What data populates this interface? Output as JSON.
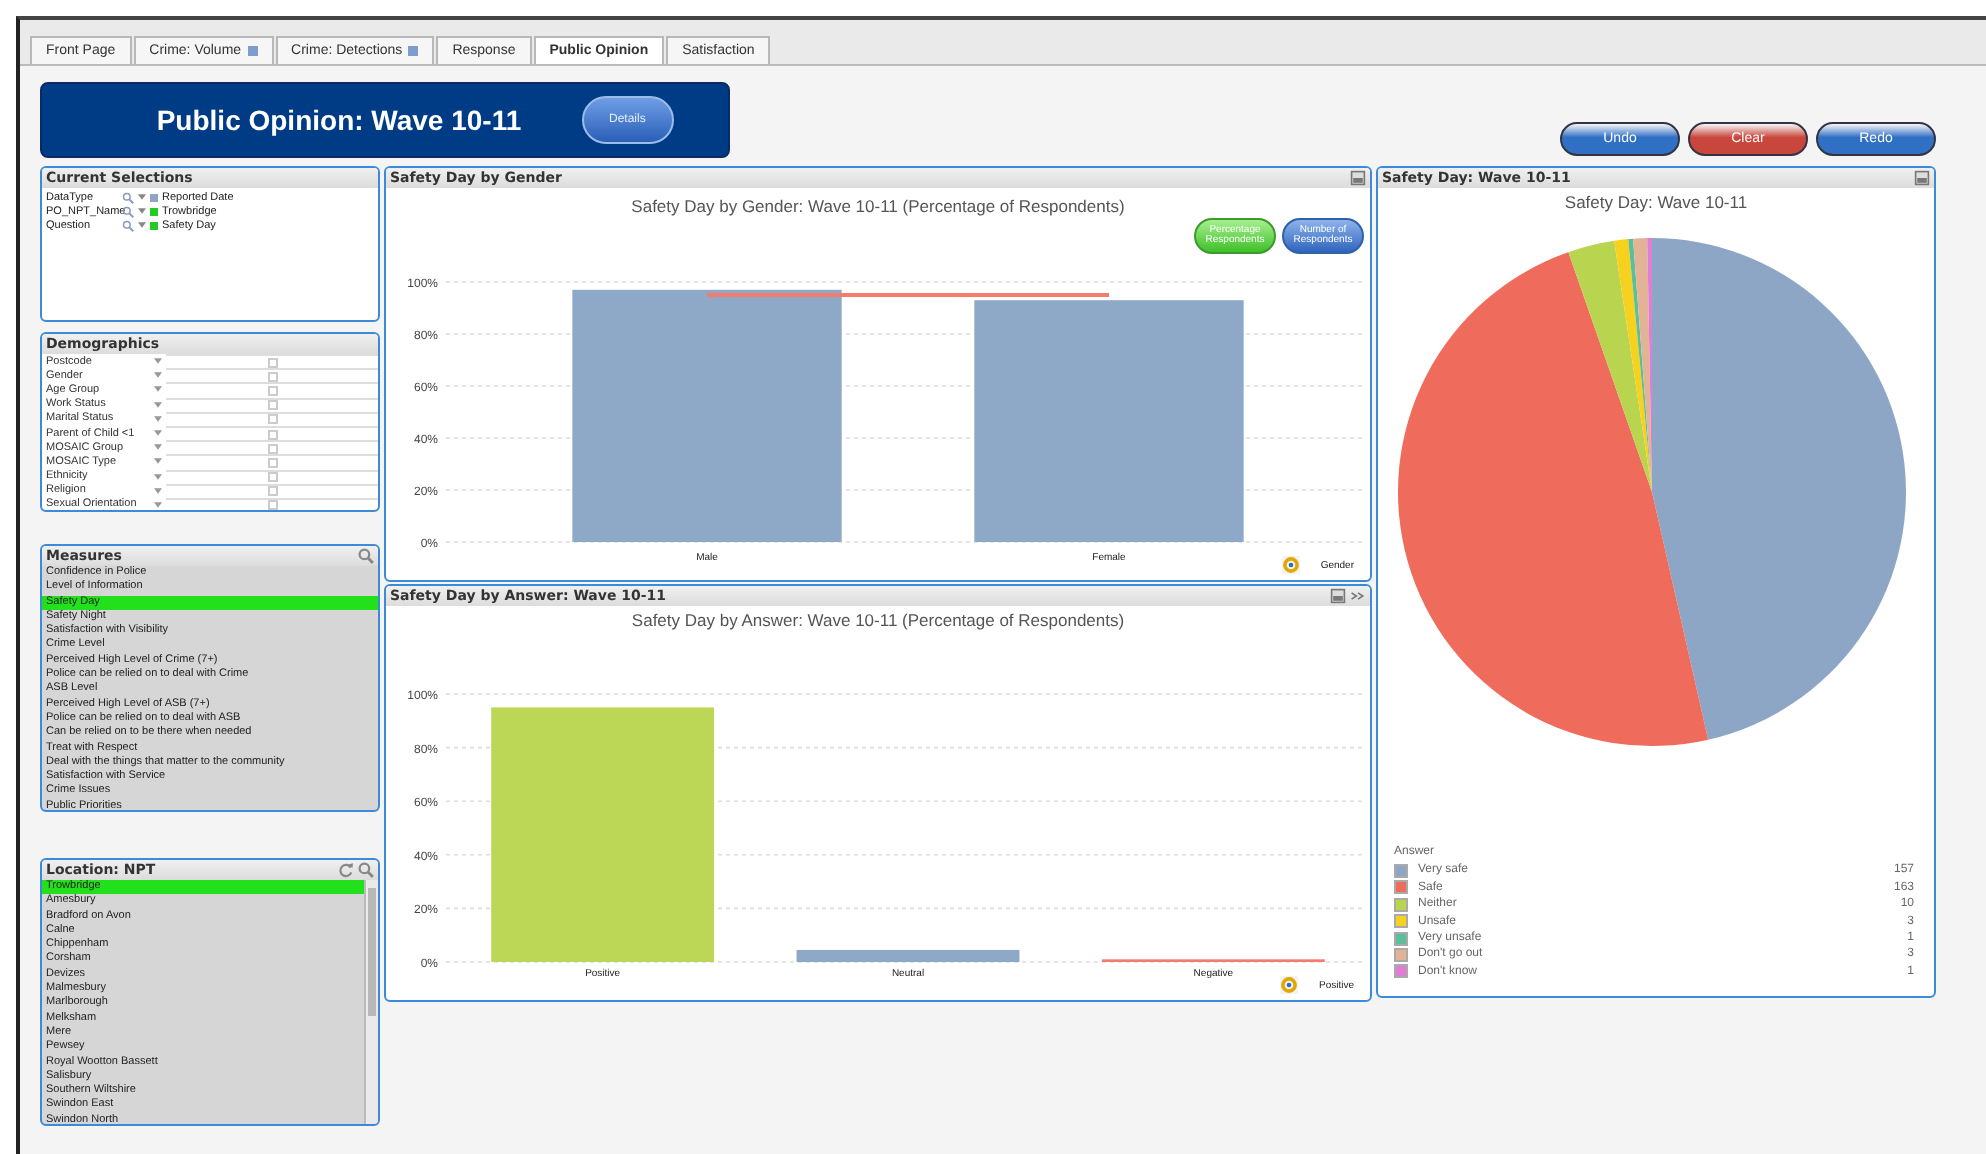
{
  "tabs": [
    {
      "label": "Front Page",
      "selected": false,
      "marker": false
    },
    {
      "label": "Crime: Volume",
      "selected": false,
      "marker": true
    },
    {
      "label": "Crime: Detections",
      "selected": false,
      "marker": true
    },
    {
      "label": "Response",
      "selected": false,
      "marker": false
    },
    {
      "label": "Public Opinion",
      "selected": true,
      "marker": false
    },
    {
      "label": "Satisfaction",
      "selected": false,
      "marker": false
    }
  ],
  "banner": {
    "title": "Public Opinion: Wave 10-11",
    "details_button": "Details"
  },
  "action_buttons": [
    {
      "label": "Undo",
      "color": "#2f6fc4"
    },
    {
      "label": "Clear",
      "color": "#c8463c"
    },
    {
      "label": "Redo",
      "color": "#2f6fc4"
    }
  ],
  "current_selections": {
    "title": "Current Selections",
    "rows": [
      {
        "field": "DataType",
        "value": "Reported Date",
        "color": "#8ea6c6"
      },
      {
        "field": "PO_NPT_Name",
        "value": "Trowbridge",
        "color": "#22cc22"
      },
      {
        "field": "Question",
        "value": "Safety Day",
        "color": "#22cc22"
      }
    ]
  },
  "demographics": {
    "title": "Demographics",
    "rows": [
      {
        "label": "Postcode",
        "checked": false
      },
      {
        "label": "Gender",
        "checked": false
      },
      {
        "label": "Age Group",
        "checked": false
      },
      {
        "label": "Work Status",
        "checked": false
      },
      {
        "label": "Marital Status",
        "checked": false
      },
      {
        "label": "Parent of Child <1",
        "checked": false
      },
      {
        "label": "MOSAIC Group",
        "checked": false
      },
      {
        "label": "MOSAIC Type",
        "checked": false
      },
      {
        "label": "Ethnicity",
        "checked": false
      },
      {
        "label": "Religion",
        "checked": false
      },
      {
        "label": "Sexual Orientation",
        "checked": false
      }
    ]
  },
  "measures": {
    "title": "Measures",
    "items": [
      {
        "label": "Confidence in Police",
        "selected": false
      },
      {
        "label": "Level of Information",
        "selected": false
      },
      {
        "label": "Safety Day",
        "selected": true
      },
      {
        "label": "Safety Night",
        "selected": false
      },
      {
        "label": "Satisfaction with Visibility",
        "selected": false
      },
      {
        "label": "Crime Level",
        "selected": false
      },
      {
        "label": "Perceived High Level of Crime (7+)",
        "selected": false
      },
      {
        "label": "Police can be relied on to deal with Crime",
        "selected": false
      },
      {
        "label": "ASB Level",
        "selected": false
      },
      {
        "label": "Perceived High Level of ASB (7+)",
        "selected": false
      },
      {
        "label": "Police can be relied on to deal with ASB",
        "selected": false
      },
      {
        "label": "Can be relied on to be there when needed",
        "selected": false
      },
      {
        "label": "Treat with Respect",
        "selected": false
      },
      {
        "label": "Deal with the things that matter to the community",
        "selected": false
      },
      {
        "label": "Satisfaction with Service",
        "selected": false
      },
      {
        "label": "Crime Issues",
        "selected": false
      },
      {
        "label": "Public Priorities",
        "selected": false
      }
    ]
  },
  "location": {
    "title": "Location: NPT",
    "items": [
      {
        "label": "Trowbridge",
        "selected": true
      },
      {
        "label": "Amesbury",
        "selected": false
      },
      {
        "label": "Bradford on Avon",
        "selected": false
      },
      {
        "label": "Calne",
        "selected": false
      },
      {
        "label": "Chippenham",
        "selected": false
      },
      {
        "label": "Corsham",
        "selected": false
      },
      {
        "label": "Devizes",
        "selected": false
      },
      {
        "label": "Malmesbury",
        "selected": false
      },
      {
        "label": "Marlborough",
        "selected": false
      },
      {
        "label": "Melksham",
        "selected": false
      },
      {
        "label": "Mere",
        "selected": false
      },
      {
        "label": "Pewsey",
        "selected": false
      },
      {
        "label": "Royal Wootton Bassett",
        "selected": false
      },
      {
        "label": "Salisbury",
        "selected": false
      },
      {
        "label": "Southern Wiltshire",
        "selected": false
      },
      {
        "label": "Swindon East",
        "selected": false
      },
      {
        "label": "Swindon North",
        "selected": false
      }
    ]
  },
  "gender_chart": {
    "caption": "Safety Day by Gender",
    "toggles": [
      {
        "label": "Percentage Respondents",
        "selected": true
      },
      {
        "label": "Number of Respondents",
        "selected": false
      }
    ],
    "chart_data": {
      "type": "bar",
      "title": "Safety Day by Gender: Wave 10-11 (Percentage of Respondents)",
      "xlabel": "Gender",
      "categories": [
        "Male",
        "Female"
      ],
      "series": [
        {
          "color": "#8ea9c8",
          "values": [
            97,
            93
          ]
        },
        {
          "type": "line",
          "color": "#f47c6c",
          "values": [
            95,
            95
          ]
        }
      ],
      "grid": true,
      "ylim": [
        0,
        100
      ],
      "yticks": [
        {
          "value": 0,
          "label": "0%"
        },
        {
          "value": 20,
          "label": "20%"
        },
        {
          "value": 40,
          "label": "40%"
        },
        {
          "value": 60,
          "label": "60%"
        },
        {
          "value": 80,
          "label": "80%"
        },
        {
          "value": 100,
          "label": "100%"
        }
      ]
    }
  },
  "answer_chart": {
    "caption": "Safety Day by Answer: Wave 10-11",
    "chart_data": {
      "type": "bar",
      "title": "Safety Day by Answer: Wave 10-11 (Percentage of Respondents)",
      "xlabel": "Positive",
      "categories": [
        "Positive",
        "Neutral",
        "Negative"
      ],
      "stacked": true,
      "series": [
        {
          "color": "#bcd755",
          "values": [
            95,
            null,
            null
          ]
        },
        {
          "color": "#8ea9c8",
          "values": [
            null,
            4.5,
            null
          ]
        },
        {
          "color": "#f47c6c",
          "values": [
            null,
            null,
            1
          ]
        }
      ],
      "grid": true,
      "ylim": [
        0,
        100
      ],
      "yticks": [
        {
          "value": 0,
          "label": "0%"
        },
        {
          "value": 20,
          "label": "20%"
        },
        {
          "value": 40,
          "label": "40%"
        },
        {
          "value": 60,
          "label": "60%"
        },
        {
          "value": 80,
          "label": "80%"
        },
        {
          "value": 100,
          "label": "100%"
        }
      ]
    }
  },
  "pie_panel": {
    "caption": "Safety Day: Wave 10-11",
    "chart_data": {
      "type": "pie",
      "title": "Safety Day: Wave 10-11",
      "categories": [
        "Very safe",
        "Safe",
        "Neither",
        "Unsafe",
        "Very unsafe",
        "Don't go out",
        "Don't know"
      ],
      "values": [
        46.45,
        48.21,
        2.96,
        0.89,
        0.3,
        0.89,
        0.3
      ]
    },
    "legend": {
      "title": "Answer",
      "items": [
        {
          "count": "157",
          "color": "#8ea6c6"
        },
        {
          "count": "163",
          "color": "#ef6b5c"
        },
        {
          "count": "10",
          "color": "#b9d44f"
        },
        {
          "count": "3",
          "color": "#f6d21e"
        },
        {
          "count": "1",
          "color": "#5cbf9a"
        },
        {
          "count": "3",
          "color": "#e3b396"
        },
        {
          "count": "1",
          "color": "#e07ed6"
        }
      ]
    }
  }
}
